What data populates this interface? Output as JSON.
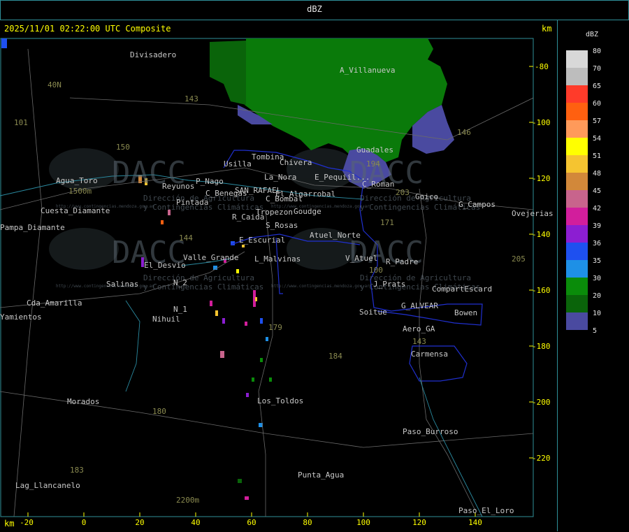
{
  "header": {
    "title": "dBZ"
  },
  "map": {
    "timestamp": "2025/11/01 02:22:00 UTC Composite",
    "unit_label_top": "km",
    "unit_label_bottom": "km",
    "x_ticks": [
      "-20",
      "0",
      "20",
      "40",
      "60",
      "80",
      "100",
      "120",
      "140"
    ],
    "y_ticks": [
      "-80",
      "-100",
      "-120",
      "-140",
      "-160",
      "-180",
      "-200",
      "-220"
    ],
    "places": [
      "Divisadero",
      "A_Villanueva",
      "40N",
      "101",
      "143",
      "Guadales",
      "146",
      "150",
      "Tombina",
      "Usilla",
      "La_Nora",
      "Chivera",
      "E_Pequiil...",
      "C_Roman",
      "Goico",
      "G_Campos",
      "Ovejerias",
      "Agua_Toro",
      "1500m",
      "Reyunos",
      "P_Nago",
      "SAN_RAFAEL",
      "El_Algarrobal",
      "C_Benegas",
      "C_Bombal",
      "Pampa_Diamante",
      "Cuesta_Diamante",
      "Pintada",
      "Tropezon",
      "Goudge",
      "R_Caida",
      "S_Rosas",
      "171",
      "Atuel_Norte",
      "E_Escurial",
      "144",
      "Valle_Grande",
      "L_Malvinas",
      "V_Atuel",
      "R_Padre",
      "205",
      "El_Desvio",
      "Salinas",
      "N_2",
      "J_Prats",
      "CompartEscard",
      "Cda_Amarilla",
      "N_1",
      "G_ALVEAR",
      "Bowen",
      "Nihuil",
      "Soitue",
      "Aero_GA",
      "Yamientos",
      "179",
      "Carmensa",
      "184",
      "Morados",
      "Los_Toldos",
      "180",
      "183",
      "Paso_Burroso",
      "Lag_Llancanelo",
      "Punta_Agua",
      "2200m",
      "Paso_El_Loro",
      "194",
      "203",
      "100",
      "143"
    ],
    "watermark": {
      "brand": "DACC",
      "line1": "Dirección de Agricultura",
      "line2": "y Contingencias Climáticas",
      "url": "http://www.contingencias.mendoza.gov.ar"
    }
  },
  "legend": {
    "title": "dBZ",
    "levels": [
      {
        "label": "80",
        "color": "#d8d8d8"
      },
      {
        "label": "70",
        "color": "#bdbdbd"
      },
      {
        "label": "65",
        "color": "#ff3b2a"
      },
      {
        "label": "60",
        "color": "#ff6010"
      },
      {
        "label": "57",
        "color": "#ff9a5a"
      },
      {
        "label": "54",
        "color": "#ffff00"
      },
      {
        "label": "51",
        "color": "#f5c430"
      },
      {
        "label": "48",
        "color": "#d2883a"
      },
      {
        "label": "45",
        "color": "#c8648c"
      },
      {
        "label": "42",
        "color": "#d21e9c"
      },
      {
        "label": "39",
        "color": "#8c1ed2"
      },
      {
        "label": "36",
        "color": "#1e50f0"
      },
      {
        "label": "35",
        "color": "#1e90e6"
      },
      {
        "label": "30",
        "color": "#0a8c0a"
      },
      {
        "label": "20",
        "color": "#0a640a"
      },
      {
        "label": "10",
        "color": "#4a4aa0"
      },
      {
        "label": "5",
        "color": ""
      }
    ]
  }
}
